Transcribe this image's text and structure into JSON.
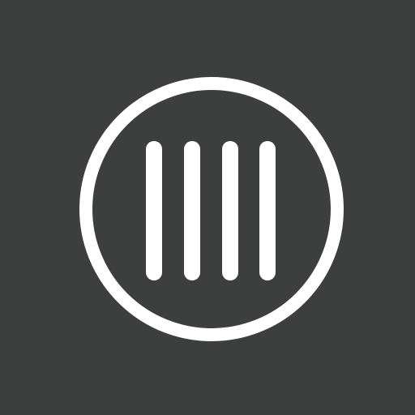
{
  "app_icon": {
    "icon_name": "four-vertical-bars-in-circle-icon",
    "background_color": "#3d3f3f",
    "foreground_color": "#ffffff",
    "bars": [
      {
        "name": "bar-1"
      },
      {
        "name": "bar-2"
      },
      {
        "name": "bar-3"
      },
      {
        "name": "bar-4"
      }
    ]
  }
}
